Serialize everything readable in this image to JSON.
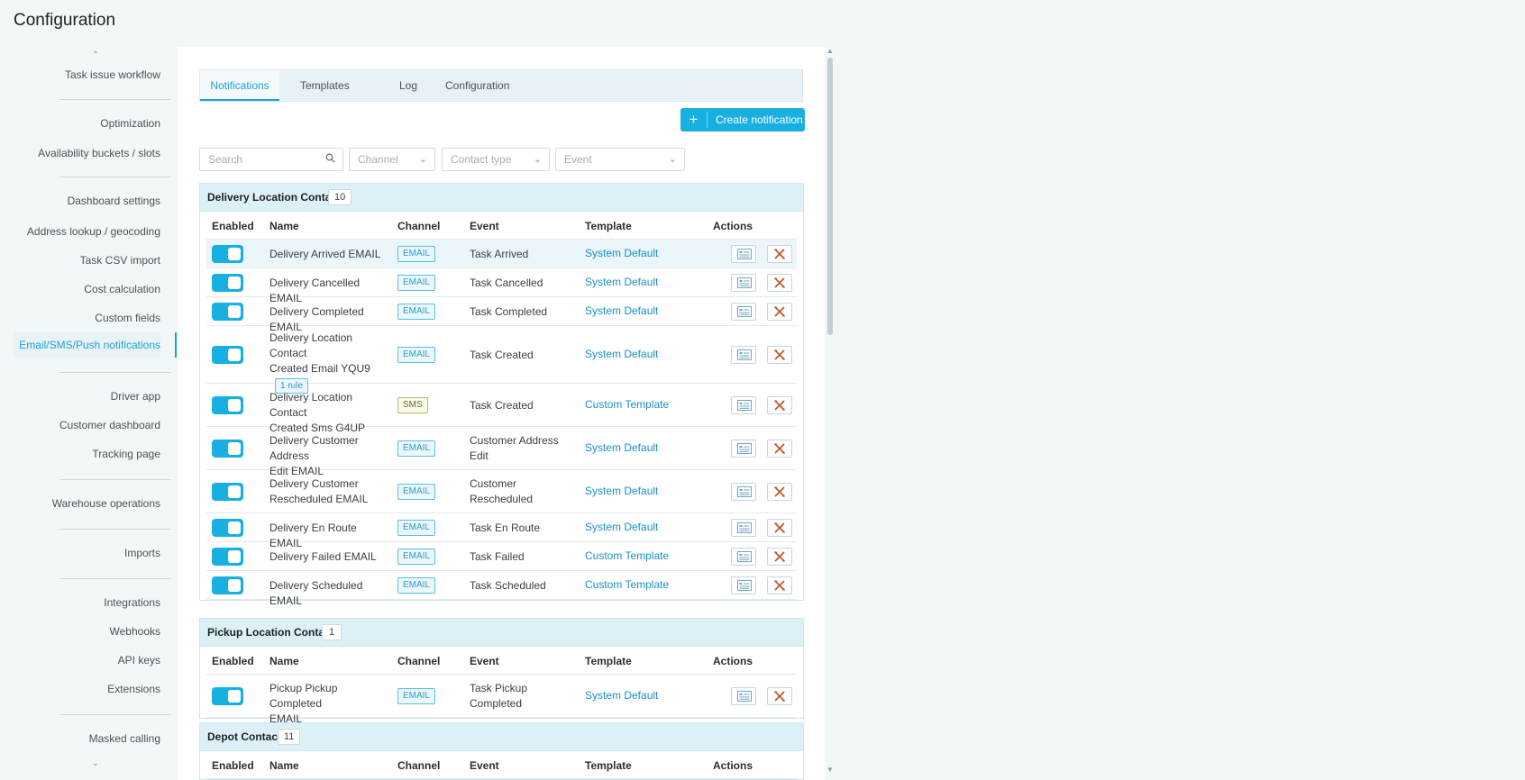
{
  "page": {
    "title": "Configuration"
  },
  "sidebar": {
    "items": [
      {
        "label": "Task issue workflow"
      },
      {
        "label": "Optimization"
      },
      {
        "label": "Availability buckets / slots"
      },
      {
        "label": "Dashboard settings"
      },
      {
        "label": "Address lookup / geocoding"
      },
      {
        "label": "Task CSV import"
      },
      {
        "label": "Cost calculation"
      },
      {
        "label": "Custom fields"
      },
      {
        "label": "Email/SMS/Push notifications",
        "active": true
      },
      {
        "label": "Driver app"
      },
      {
        "label": "Customer dashboard"
      },
      {
        "label": "Tracking page"
      },
      {
        "label": "Warehouse operations"
      },
      {
        "label": "Imports"
      },
      {
        "label": "Integrations"
      },
      {
        "label": "Webhooks"
      },
      {
        "label": "API keys"
      },
      {
        "label": "Extensions"
      },
      {
        "label": "Masked calling"
      }
    ]
  },
  "tabs": [
    {
      "label": "Notifications",
      "active": true
    },
    {
      "label": "Templates"
    },
    {
      "label": "Log"
    },
    {
      "label": "Configuration"
    }
  ],
  "toolbar": {
    "create_label": "Create notification"
  },
  "filters": {
    "search_placeholder": "Search",
    "channel": "Channel",
    "contact_type": "Contact type",
    "event": "Event"
  },
  "columns": {
    "enabled": "Enabled",
    "name": "Name",
    "channel": "Channel",
    "event": "Event",
    "template": "Template",
    "actions": "Actions"
  },
  "groups": [
    {
      "title": "Delivery Location Contact",
      "count": "10",
      "rows": [
        {
          "name": [
            "Delivery Arrived EMAIL"
          ],
          "channel": "EMAIL",
          "event": [
            "Task Arrived"
          ],
          "template": "System Default",
          "enabled": true
        },
        {
          "name": [
            "Delivery Cancelled EMAIL"
          ],
          "channel": "EMAIL",
          "event": [
            "Task Cancelled"
          ],
          "template": "System Default",
          "enabled": true
        },
        {
          "name": [
            "Delivery Completed EMAIL"
          ],
          "channel": "EMAIL",
          "event": [
            "Task Completed"
          ],
          "template": "System Default",
          "enabled": true
        },
        {
          "name": [
            "Delivery Location Contact",
            "Created Email YQU9"
          ],
          "rule": "1 rule",
          "channel": "EMAIL",
          "event": [
            "Task Created"
          ],
          "template": "System Default",
          "enabled": true
        },
        {
          "name": [
            "Delivery Location Contact",
            "Created Sms G4UP"
          ],
          "channel": "SMS",
          "event": [
            "Task Created"
          ],
          "template": "Custom Template",
          "enabled": true
        },
        {
          "name": [
            "Delivery Customer Address",
            "Edit EMAIL"
          ],
          "channel": "EMAIL",
          "event": [
            "Customer Address",
            "Edit"
          ],
          "template": "System Default",
          "enabled": true
        },
        {
          "name": [
            "Delivery Customer",
            "Rescheduled EMAIL"
          ],
          "channel": "EMAIL",
          "event": [
            "Customer",
            "Rescheduled"
          ],
          "template": "System Default",
          "enabled": true
        },
        {
          "name": [
            "Delivery En Route EMAIL"
          ],
          "channel": "EMAIL",
          "event": [
            "Task En Route"
          ],
          "template": "System Default",
          "enabled": true
        },
        {
          "name": [
            "Delivery Failed EMAIL"
          ],
          "channel": "EMAIL",
          "event": [
            "Task Failed"
          ],
          "template": "Custom Template",
          "enabled": true
        },
        {
          "name": [
            "Delivery Scheduled EMAIL"
          ],
          "channel": "EMAIL",
          "event": [
            "Task Scheduled"
          ],
          "template": "Custom Template",
          "enabled": true
        }
      ]
    },
    {
      "title": "Pickup Location Contact",
      "count": "1",
      "rows": [
        {
          "name": [
            "Pickup Pickup Completed",
            "EMAIL"
          ],
          "channel": "EMAIL",
          "event": [
            "Task Pickup",
            "Completed"
          ],
          "template": "System Default",
          "enabled": true
        }
      ]
    },
    {
      "title": "Depot Contact",
      "count": "11",
      "rows": []
    }
  ],
  "colors": {
    "accent": "#18b0e0",
    "link": "#1a8fc4",
    "group_header": "#dcf1f7",
    "page_bg": "#f2f7f8",
    "delete_icon": "#c0562c"
  }
}
